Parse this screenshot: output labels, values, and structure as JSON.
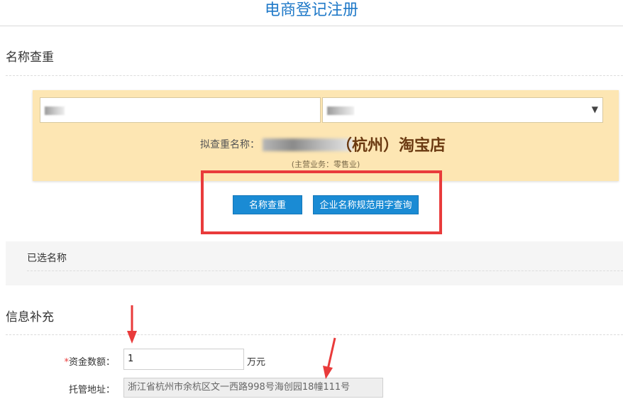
{
  "header": {
    "title": "电商登记注册"
  },
  "name_check": {
    "section_title": "名称查重",
    "proposed_label": "拟查重名称：",
    "proposed_name_suffix": "（杭州）淘宝店",
    "business_note": "(主营业务：零售业)",
    "check_button": "名称查重",
    "norm_button": "企业名称规范用字查询"
  },
  "selected": {
    "title": "已选名称"
  },
  "info": {
    "section_title": "信息补充",
    "capital_label": "资金数额：",
    "capital_star": "*",
    "capital_value": "1",
    "capital_unit": "万元",
    "address_label": "托管地址：",
    "address_value": "浙江省杭州市余杭区文一西路998号海创园18幢111号"
  },
  "colors": {
    "accent": "#1a8bd4",
    "title": "#1f79c8",
    "highlight": "#e93b3b",
    "panel": "#fde6b3"
  }
}
